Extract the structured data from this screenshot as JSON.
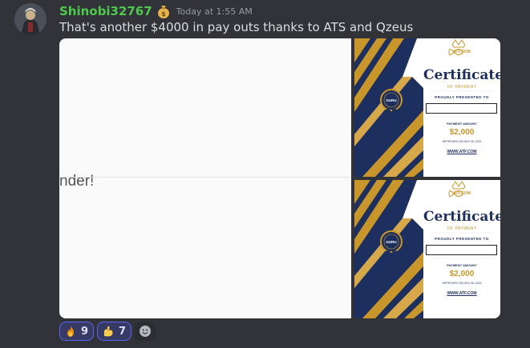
{
  "message": {
    "username": "Shinobi32767",
    "timestamp": "Today at 1:55 AM",
    "text": "That's another $4000 in pay outs thanks to ATS and Qzeus"
  },
  "attachments": {
    "left_image_text_fragment": "nder!",
    "certificates": [
      {
        "brand": "ATF.COM",
        "title": "Certificate",
        "subtitle": "OF PAYMENT",
        "presented_to": "PROUDLY PRESENTED TO",
        "amount_label": "PAYMENT AMOUNT",
        "amount": "$2,000",
        "approved": "APPROVED ON NOV 06, 2023",
        "website": "WWW.ATF.COM",
        "seal_text": "GURU"
      },
      {
        "brand": "ATF.COM",
        "title": "Certificate",
        "subtitle": "OF PAYMENT",
        "presented_to": "PROUDLY PRESENTED TO",
        "amount_label": "PAYMENT AMOUNT",
        "amount": "$2,000",
        "approved": "APPROVED ON NOV 06, 2023",
        "website": "WWW.ATF.COM",
        "seal_text": "GURU"
      }
    ]
  },
  "reactions": [
    {
      "emoji": "fire",
      "count": "9"
    },
    {
      "emoji": "flexed-biceps",
      "count": "7"
    }
  ],
  "colors": {
    "background": "#313338",
    "username": "#4ec94e",
    "reaction_bg": "#373a64",
    "reaction_border": "#5865f2",
    "cert_navy": "#1d2f5e",
    "cert_gold": "#c8962a"
  }
}
